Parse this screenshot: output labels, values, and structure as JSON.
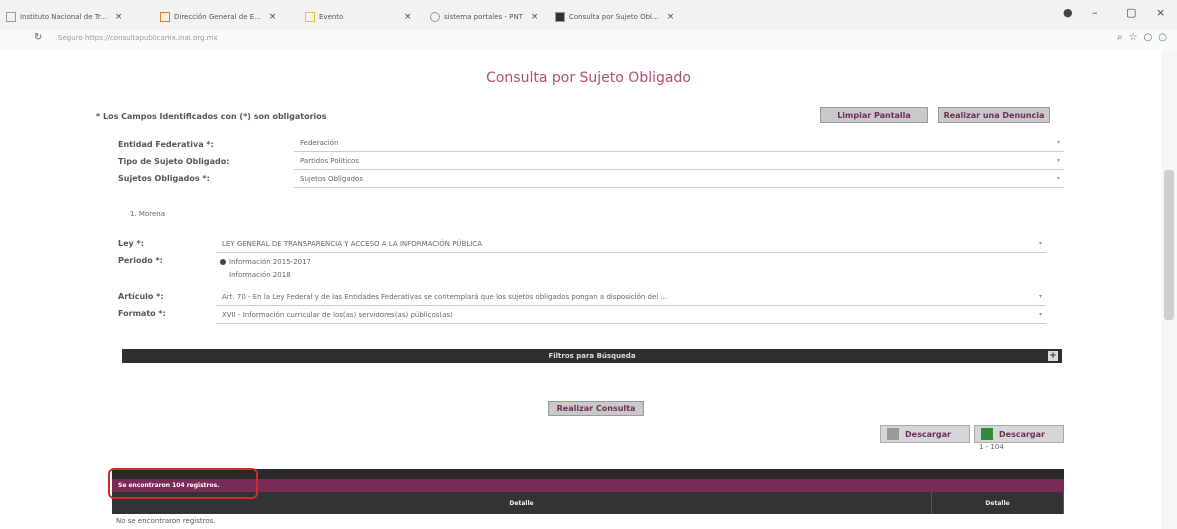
{
  "browser": {
    "tabs": [
      {
        "label": "Instituto Nacional de Tr..."
      },
      {
        "label": "Dirección General de E..."
      },
      {
        "label": "Evento"
      },
      {
        "label": "sistema portales - PNT"
      },
      {
        "label": "Consulta por Sujeto Obl..."
      }
    ],
    "address": "Seguro   https://consultapublicamx.inai.org.mx"
  },
  "page": {
    "title": "Consulta por Sujeto Obligado",
    "required_note": "* Los Campos Identificados con (*) son obligatorios",
    "buttons": {
      "clear": "Limpiar Pantalla",
      "report": "Realizar una Denuncia",
      "query": "Realizar Consulta"
    }
  },
  "form": {
    "entidad_label": "Entidad Federativa *:",
    "entidad_value": "Federación",
    "tipo_label": "Tipo de Sujeto Obligado:",
    "tipo_value": "Partidos Políticos",
    "sujetos_label": "Sujetos Obligados *:",
    "sujetos_value": "Sujetos Obligados",
    "selected_subject": "1. Morena",
    "ley_label": "Ley *:",
    "ley_value": "LEY GENERAL DE TRANSPARENCIA Y ACCESO A LA INFORMACIÓN PÚBLICA",
    "periodo_label": "Periodo *:",
    "periodo_option1": "Información 2015-2017",
    "periodo_option2": "Información 2018",
    "articulo_label": "Artículo *:",
    "articulo_value": "Art. 70 - En la Ley Federal y de las Entidades Federativas se contemplará que los sujetos obligados pongan a disposición del ...",
    "formato_label": "Formato *:",
    "formato_value": "XVII - Información curricular de los(as) servidores(as) públicos(as)"
  },
  "filters": {
    "label": "Filtros para Búsqueda",
    "toggle": "+"
  },
  "results": {
    "download1": "Descargar",
    "download2": "Descargar",
    "pager": "1 - 104",
    "found_text": "Se encontraron 104 registros.",
    "col1": "Detalle",
    "col2": "Detalle",
    "empty": "No se encontraron registros."
  },
  "colors": {
    "accent": "#b24d78",
    "bar": "#7a2a55",
    "highlight": "#d62a2a"
  }
}
